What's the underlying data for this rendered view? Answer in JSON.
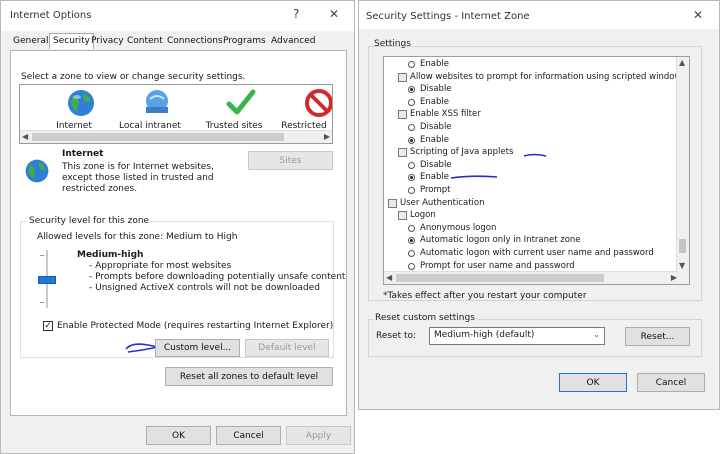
{
  "internet_options": {
    "title": "Internet Options",
    "controls": {
      "help": "?",
      "close": "✕"
    },
    "tabs": [
      "General",
      "Security",
      "Privacy",
      "Content",
      "Connections",
      "Programs",
      "Advanced"
    ],
    "active_tab": "Security",
    "select_zone_prompt": "Select a zone to view or change security settings.",
    "zones": [
      {
        "label": "Internet",
        "icon": "globe-icon"
      },
      {
        "label": "Local intranet",
        "icon": "network-icon"
      },
      {
        "label": "Trusted sites",
        "icon": "checkmark-icon"
      },
      {
        "label": "Restricted",
        "icon": "restricted-icon"
      }
    ],
    "zone_info": {
      "name": "Internet",
      "description_lines": [
        "This zone is for Internet websites,",
        "except those listed in trusted and",
        "restricted zones."
      ]
    },
    "sites_button": "Sites",
    "security_level": {
      "group_title": "Security level for this zone",
      "allowed": "Allowed levels for this zone: Medium to High",
      "level_name": "Medium-high",
      "bullets": [
        "- Appropriate for most websites",
        "- Prompts before downloading potentially unsafe content",
        "- Unsigned ActiveX controls will not be downloaded"
      ],
      "slider_level": 0.5
    },
    "protected_mode": {
      "label": "Enable Protected Mode (requires restarting Internet Explorer)",
      "checked": true
    },
    "custom_level_button": "Custom level...",
    "default_level_button": "Default level",
    "reset_all_button": "Reset all zones to default level",
    "footer": {
      "ok": "OK",
      "cancel": "Cancel",
      "apply": "Apply"
    }
  },
  "security_settings": {
    "title": "Security Settings - Internet Zone",
    "close": "✕",
    "settings_label": "Settings",
    "items": [
      {
        "type": "radio",
        "label": "Enable",
        "selected": false
      },
      {
        "type": "group",
        "label": "Allow websites to prompt for information using scripted windows"
      },
      {
        "type": "radio",
        "label": "Disable",
        "selected": true
      },
      {
        "type": "radio",
        "label": "Enable",
        "selected": false
      },
      {
        "type": "group",
        "label": "Enable XSS filter"
      },
      {
        "type": "radio",
        "label": "Disable",
        "selected": false
      },
      {
        "type": "radio",
        "label": "Enable",
        "selected": true
      },
      {
        "type": "group",
        "label": "Scripting of Java applets"
      },
      {
        "type": "radio",
        "label": "Disable",
        "selected": false
      },
      {
        "type": "radio",
        "label": "Enable",
        "selected": true
      },
      {
        "type": "radio",
        "label": "Prompt",
        "selected": false
      },
      {
        "type": "section",
        "label": "User Authentication"
      },
      {
        "type": "subgroup",
        "label": "Logon"
      },
      {
        "type": "radio",
        "label": "Anonymous logon",
        "selected": false
      },
      {
        "type": "radio",
        "label": "Automatic logon only in Intranet zone",
        "selected": true
      },
      {
        "type": "radio",
        "label": "Automatic logon with current user name and password",
        "selected": false
      },
      {
        "type": "radio",
        "label": "Prompt for user name and password",
        "selected": false
      }
    ],
    "note": "*Takes effect after you restart your computer",
    "reset_group_title": "Reset custom settings",
    "reset_to_label": "Reset to:",
    "reset_to_value": "Medium-high (default)",
    "reset_button": "Reset...",
    "ok": "OK",
    "cancel": "Cancel"
  }
}
